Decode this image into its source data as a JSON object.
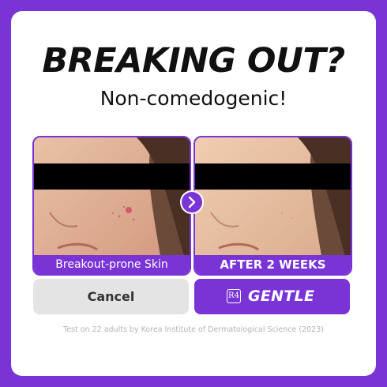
{
  "headline": "BREAKING OUT?",
  "subheadline": "Non-comedogenic!",
  "panels": {
    "before_label": "Breakout-prone Skin",
    "after_label": "AFTER 2 WEEKS"
  },
  "buttons": {
    "cancel_label": "Cancel",
    "brand_mark": "R4",
    "gentle_label": "GENTLE"
  },
  "footnote": "Test on 22 adults by Korea Institute of Dermatological Science (2023)",
  "icons": {
    "arrow": "chevron-right-icon",
    "brand": "r4-logo-icon"
  },
  "colors": {
    "accent": "#7a34d6",
    "cancel_bg": "#e4e4e4",
    "footnote": "#b3b3b3"
  }
}
